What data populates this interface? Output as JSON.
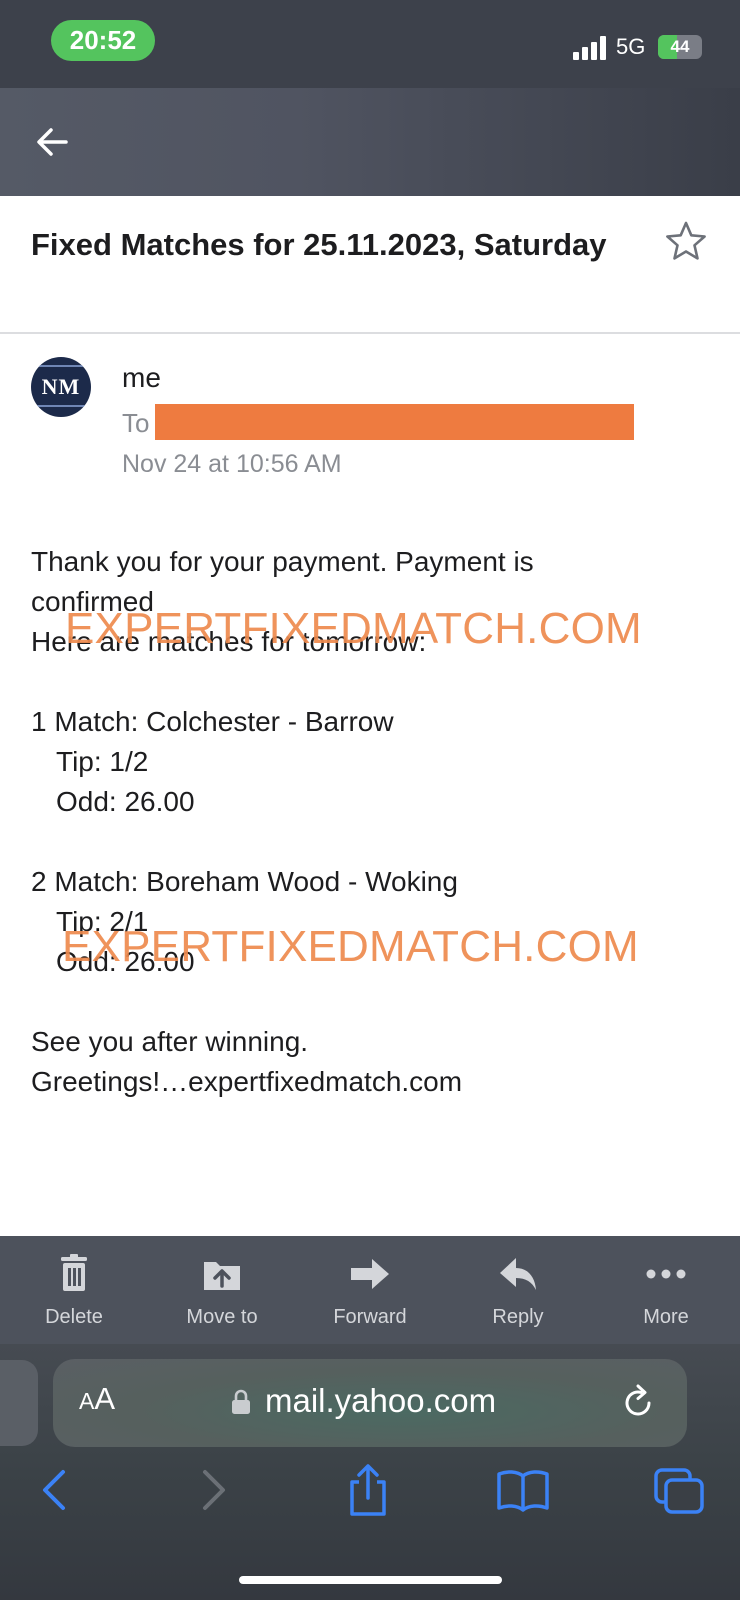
{
  "status_bar": {
    "time": "20:52",
    "network": "5G",
    "battery": "44",
    "battery_level": 0.44
  },
  "header": {
    "back_icon": "arrow-left-icon"
  },
  "email": {
    "subject": "Fixed Matches for 25.11.2023, Saturday",
    "star_icon": "star-outline-icon",
    "avatar_initials": "NM",
    "sender": "me",
    "to_label": "To",
    "date": "Nov 24 at 10:56 AM",
    "body": {
      "line1": "Thank you for your payment. Payment is",
      "line2": "confirmed",
      "line3": "Here are matches for tomorrow:",
      "match1": {
        "title": "1 Match: Colchester - Barrow",
        "tip": "Tip: 1/2",
        "odd": "Odd: 26.00"
      },
      "match2": {
        "title": "2 Match: Boreham Wood - Woking",
        "tip": "Tip: 2/1",
        "odd": "Odd: 26.00"
      },
      "closing1": "See you after winning.",
      "closing2": "Greetings!…expertfixedmatch.com"
    },
    "watermark_text": "EXPERTFIXEDMATCH.COM"
  },
  "toolbar": {
    "items": [
      {
        "label": "Delete",
        "icon": "trash-icon"
      },
      {
        "label": "Move to",
        "icon": "folder-move-icon"
      },
      {
        "label": "Forward",
        "icon": "forward-arrow-icon"
      },
      {
        "label": "Reply",
        "icon": "reply-arrow-icon"
      },
      {
        "label": "More",
        "icon": "more-dots-icon"
      }
    ]
  },
  "browser": {
    "aa_big": "A",
    "aa_small": "A",
    "url": "mail.yahoo.com",
    "colors": {
      "accent": "#3b82f6",
      "disabled": "#6b7076"
    }
  },
  "colors": {
    "status_green": "#54c45e",
    "redaction": "#ee7b40",
    "watermark": "#ee8a4e"
  }
}
